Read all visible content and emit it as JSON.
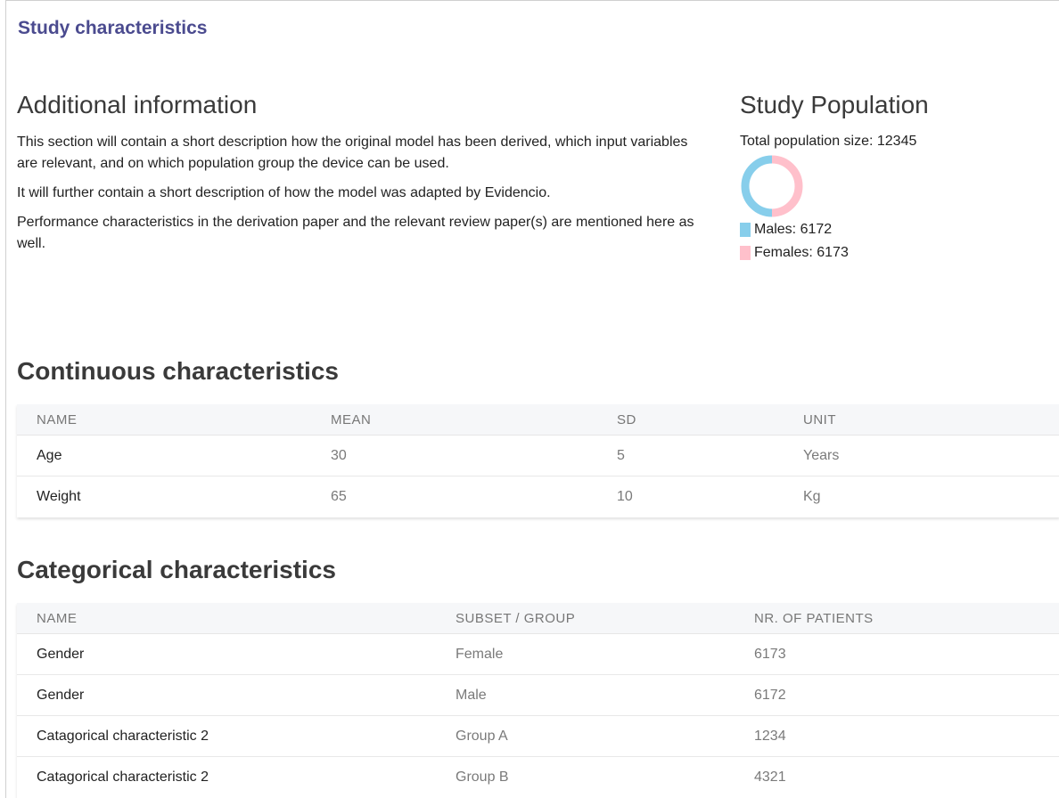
{
  "section_title": "Study characteristics",
  "additional": {
    "heading": "Additional information",
    "paragraphs": [
      "This section will contain a short description how the original model has been derived, which input variables are relevant, and on which population group the device can be used.",
      "It will further contain a short description of how the model was adapted by Evidencio.",
      "Performance characteristics in the derivation paper and the relevant review paper(s) are mentioned here as well."
    ]
  },
  "population": {
    "heading": "Study Population",
    "total_label": "Total population size: 12345",
    "males_label": "Males: 6172",
    "females_label": "Females: 6173",
    "males_color": "#87ceeb",
    "females_color": "#ffc0cb"
  },
  "chart_data": {
    "type": "pie",
    "categories": [
      "Males",
      "Females"
    ],
    "values": [
      6172,
      6173
    ]
  },
  "continuous": {
    "heading": "Continuous characteristics",
    "columns": [
      "NAME",
      "MEAN",
      "SD",
      "UNIT"
    ],
    "rows": [
      [
        "Age",
        "30",
        "5",
        "Years"
      ],
      [
        "Weight",
        "65",
        "10",
        "Kg"
      ]
    ]
  },
  "categorical": {
    "heading": "Categorical characteristics",
    "columns": [
      "NAME",
      "SUBSET / GROUP",
      "NR. OF PATIENTS"
    ],
    "rows": [
      [
        "Gender",
        "Female",
        "6173"
      ],
      [
        "Gender",
        "Male",
        "6172"
      ],
      [
        "Catagorical characteristic 2",
        "Group A",
        "1234"
      ],
      [
        "Catagorical characteristic 2",
        "Group B",
        "4321"
      ]
    ]
  }
}
